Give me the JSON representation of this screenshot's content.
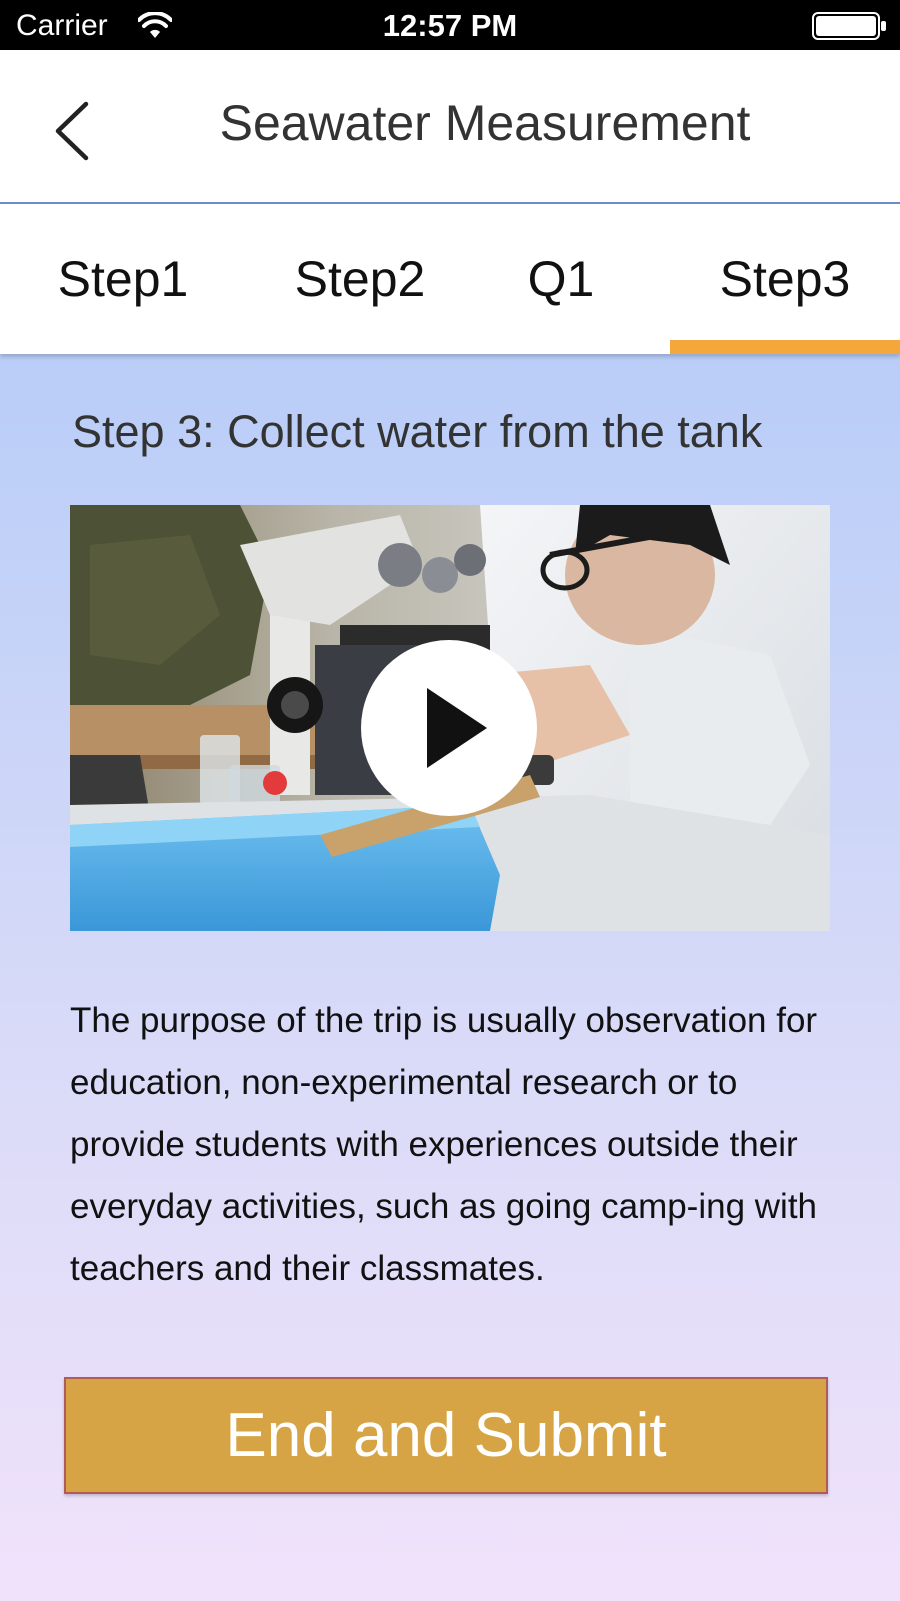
{
  "status_bar": {
    "carrier": "Carrier",
    "time": "12:57 PM",
    "wifi_icon": "wifi-icon",
    "battery_icon": "battery-icon"
  },
  "header": {
    "back_icon": "chevron-left-icon",
    "title": "Seawater Measurement"
  },
  "tabs": [
    {
      "label": "Step1",
      "selected": false
    },
    {
      "label": "Step2",
      "selected": false
    },
    {
      "label": "Q1",
      "selected": false
    },
    {
      "label": "Step3",
      "selected": true
    }
  ],
  "content": {
    "heading": "Step 3: Collect water from the tank",
    "video": {
      "play_icon": "play-icon"
    },
    "description": "The purpose of the trip is usually observation for education, non-experimental research or to provide students with experiences outside their everyday activities, such as going camp-ing with teachers and their classmates."
  },
  "submit_label": "End and Submit",
  "colors": {
    "tab_indicator": "#f4a83b",
    "submit_button": "#d6a444",
    "background_top": "#a9c6f7",
    "background_bottom": "#f1e2fb"
  }
}
